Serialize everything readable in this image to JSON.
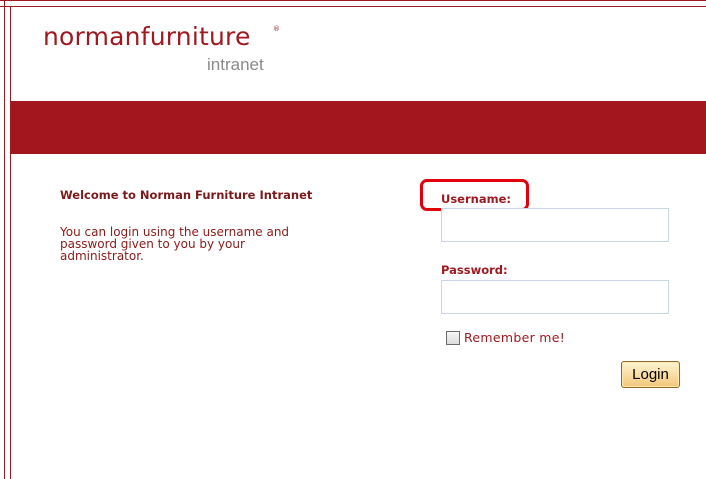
{
  "brand": {
    "name_part1": "norman",
    "name_part2": "furniture",
    "registered_mark": "®",
    "subtitle": "intranet"
  },
  "welcome": {
    "title": "Welcome to Norman Furniture Intranet",
    "line1": "You can login using the username and",
    "line2": "password given to you by your",
    "line3": "administrator."
  },
  "form": {
    "username_label": "Username:",
    "username_value": "",
    "password_label": "Password:",
    "password_value": "",
    "remember_label": "Remember me!",
    "remember_checked": false,
    "login_label": "Login"
  },
  "colors": {
    "brand_red": "#a3161d",
    "highlight_red": "#e3000b",
    "logo_gray": "#8a8a8a"
  }
}
